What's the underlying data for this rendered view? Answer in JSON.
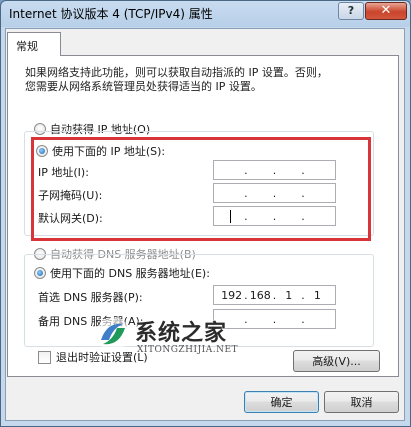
{
  "window": {
    "title": "Internet 协议版本 4 (TCP/IPv4) 属性",
    "help_label": "?",
    "close_label": "✕"
  },
  "tabs": [
    {
      "label": "常规"
    }
  ],
  "description": {
    "line1": "如果网络支持此功能，则可以获取自动指派的 IP 设置。否则，",
    "line2": "您需要从网络系统管理员处获得适当的 IP 设置。"
  },
  "ip_section": {
    "auto_option": {
      "label": "自动获得 IP 地址(O)",
      "selected": false
    },
    "manual_option": {
      "label": "使用下面的 IP 地址(S):",
      "selected": true
    },
    "fields": [
      {
        "label": "IP 地址(I):",
        "octets": [
          "",
          "",
          "",
          ""
        ]
      },
      {
        "label": "子网掩码(U):",
        "octets": [
          "",
          "",
          "",
          ""
        ]
      },
      {
        "label": "默认网关(D):",
        "octets": [
          "",
          "",
          "",
          ""
        ]
      }
    ]
  },
  "dns_section": {
    "auto_option": {
      "label": "自动获得 DNS 服务器地址(B)",
      "selected": false,
      "disabled": true
    },
    "manual_option": {
      "label": "使用下面的 DNS 服务器地址(E):",
      "selected": true
    },
    "fields": [
      {
        "label": "首选 DNS 服务器(P):",
        "octets": [
          "192",
          "168",
          "1",
          "1"
        ]
      },
      {
        "label": "备用 DNS 服务器(A):",
        "octets": [
          "",
          "",
          "",
          ""
        ]
      }
    ]
  },
  "validate_checkbox": {
    "label": "退出时验证设置(L)",
    "checked": false
  },
  "buttons": {
    "advanced": "高级(V)...",
    "ok": "确定",
    "cancel": "取消"
  },
  "watermark": {
    "brand": "系统之家",
    "url": "XITONGZHIJIA.NET"
  },
  "colors": {
    "highlight_border": "#d9343a",
    "title_gradient": "#b7cfe8",
    "close_button": "#c9452c"
  }
}
